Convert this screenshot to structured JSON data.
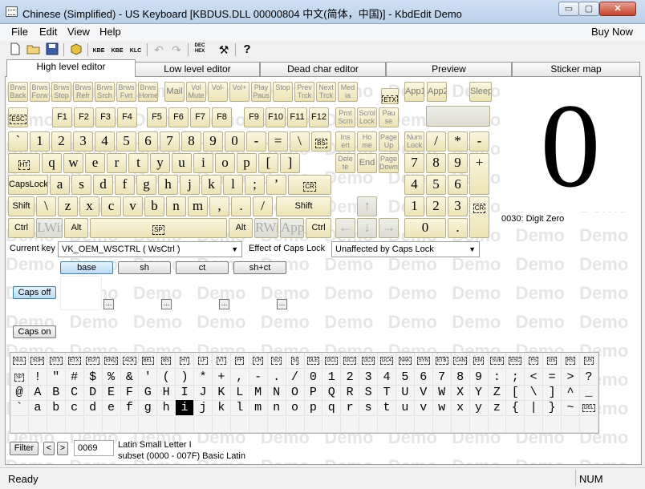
{
  "window": {
    "title": "Chinese (Simplified) - US Keyboard [KBDUS.DLL 00000804 中文(简体，中国)] - KbdEdit Demo",
    "minimize": "▭",
    "maximize": "▢",
    "close": "✕"
  },
  "menu": {
    "items": [
      "File",
      "Edit",
      "View",
      "Help"
    ],
    "buy_now": "Buy Now"
  },
  "toolbar": {
    "icons": [
      "new-file",
      "open-folder",
      "save",
      "package",
      "kbe-file",
      "kbe-save",
      "klc-file",
      "undo",
      "redo",
      "dec-hex",
      "tools",
      "help"
    ]
  },
  "tabs": [
    "High level editor",
    "Low level editor",
    "Dead char editor",
    "Preview",
    "Sticker map"
  ],
  "watermark": "Demo",
  "keyboard": {
    "media": [
      "Brws Back",
      "Brws Forw",
      "Brws Stop",
      "Brws Refr",
      "Brws Srch",
      "Brws Fvrt",
      "Brws Home",
      "Mail",
      "Vol Mute",
      "Vol-",
      "Vol+",
      "Play Paus",
      "Stop",
      "Prev Trck",
      "Next Trck",
      "Med ia"
    ],
    "app_keys": [
      "App1",
      "App2",
      "Sleep"
    ],
    "etx": "ETX",
    "esc": "ESC",
    "fkeys": [
      "F1",
      "F2",
      "F3",
      "F4",
      "F5",
      "F6",
      "F7",
      "F8",
      "F9",
      "F10",
      "F11",
      "F12"
    ],
    "right_top": [
      "Prnt Scrn",
      "Scrol Lock",
      "Pau se"
    ],
    "row1": [
      "`",
      "1",
      "2",
      "3",
      "4",
      "5",
      "6",
      "7",
      "8",
      "9",
      "0",
      "-",
      "=",
      "\\"
    ],
    "row1_end": "BS",
    "row2_start": "HT",
    "row2": [
      "q",
      "w",
      "e",
      "r",
      "t",
      "y",
      "u",
      "i",
      "o",
      "p",
      "[",
      "]"
    ],
    "row3_start": "CapsLock",
    "row3": [
      "a",
      "s",
      "d",
      "f",
      "g",
      "h",
      "j",
      "k",
      "l",
      ";",
      "’"
    ],
    "row3_end": "CR",
    "row4_start": "Shift",
    "row4": [
      "\\",
      "z",
      "x",
      "c",
      "v",
      "b",
      "n",
      "m",
      ",",
      ".",
      "/"
    ],
    "row4_end": "Shift",
    "row5": [
      "Ctrl",
      "LWin",
      "Alt",
      "SP",
      "Alt",
      "RWin",
      "Apps",
      "Ctrl"
    ],
    "nav": [
      "Ins ert",
      "Ho me",
      "Page Up",
      "Dele te",
      "End",
      "Page Down"
    ],
    "arrows": [
      "↑",
      "←",
      "↓",
      "→"
    ],
    "numpad": [
      "Num Lock",
      "/",
      "*",
      "-",
      "7",
      "8",
      "9",
      "+",
      "4",
      "5",
      "6",
      "1",
      "2",
      "3",
      "0",
      ".",
      "CR"
    ]
  },
  "preview": {
    "glyph": "0",
    "caption": "0030: Digit Zero"
  },
  "current_key": {
    "label": "Current key",
    "value": "VK_OEM_WSCTRL ( WsCtrl )"
  },
  "caps_effect": {
    "label": "Effect of Caps Lock",
    "value": "Unaffected by Caps Lock"
  },
  "shift_states": [
    "base",
    "sh",
    "ct",
    "sh+ct"
  ],
  "caps_buttons": {
    "off": "Caps off",
    "on": "Caps on"
  },
  "ellipsis": "...",
  "charmap": {
    "row0": [
      "NUL",
      "SOH",
      "STX",
      "ETX",
      "EOT",
      "ENQ",
      "ACK",
      "BEL",
      "BS",
      "HT",
      "LF",
      "VT",
      "FF",
      "CR",
      "SO",
      "SI",
      "DLE",
      "DC1",
      "DC2",
      "DC3",
      "DC4",
      "NAK",
      "SYN",
      "ETB",
      "CAN",
      "EM",
      "SUB",
      "ESC",
      "FS",
      "GS",
      "RS",
      "US"
    ],
    "row1": [
      "SP",
      "!",
      "\"",
      "#",
      "$",
      "%",
      "&",
      "'",
      "(",
      ")",
      "*",
      "+",
      ",",
      "-",
      ".",
      "/",
      "0",
      "1",
      "2",
      "3",
      "4",
      "5",
      "6",
      "7",
      "8",
      "9",
      ":",
      ";",
      "<",
      "=",
      ">",
      "?"
    ],
    "row2": [
      "@",
      "A",
      "B",
      "C",
      "D",
      "E",
      "F",
      "G",
      "H",
      "I",
      "J",
      "K",
      "L",
      "M",
      "N",
      "O",
      "P",
      "Q",
      "R",
      "S",
      "T",
      "U",
      "V",
      "W",
      "X",
      "Y",
      "Z",
      "[",
      "\\",
      "]",
      "^",
      "_"
    ],
    "row3": [
      "`",
      "a",
      "b",
      "c",
      "d",
      "e",
      "f",
      "g",
      "h",
      "i",
      "j",
      "k",
      "l",
      "m",
      "n",
      "o",
      "p",
      "q",
      "r",
      "s",
      "t",
      "u",
      "v",
      "w",
      "x",
      "y",
      "z",
      "{",
      "|",
      "}",
      "~",
      "DEL"
    ]
  },
  "filter": {
    "button": "Filter",
    "prev": "<",
    "next": ">",
    "code": "0069",
    "char_name": "Latin Small Letter I",
    "subset": "subset (0000 - 007F) Basic Latin"
  },
  "status": {
    "text": "Ready",
    "num": "NUM"
  }
}
